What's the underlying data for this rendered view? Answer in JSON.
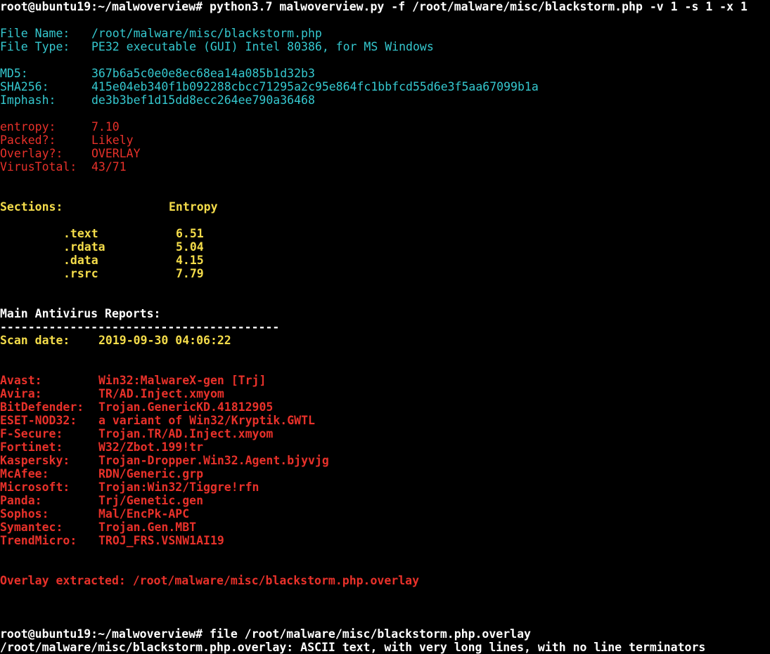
{
  "terminal": {
    "command_line": "root@ubuntu19:~/malwoverview# python3.7 malwoverview.py -f /root/malware/misc/blackstorm.php -v 1 -s 1 -x 1",
    "file_info": {
      "file_name_label": "File Name:",
      "file_name_value": "/root/malware/misc/blackstorm.php",
      "file_type_label": "File Type:",
      "file_type_value": "PE32 executable (GUI) Intel 80386, for MS Windows"
    },
    "hashes": {
      "md5_label": "MD5:",
      "md5_value": "367b6a5c0e0e8ec68ea14a085b1d32b3",
      "sha256_label": "SHA256:",
      "sha256_value": "415e04eb340f1b092288cbcc71295a2c95e864fc1bbfcd55d6e3f5aa67099b1a",
      "imphash_label": "Imphash:",
      "imphash_value": "de3b3bef1d15dd8ecc264ee790a36468"
    },
    "summary": {
      "entropy_label": "entropy:",
      "entropy_value": "7.10",
      "packed_label": "Packed?:",
      "packed_value": "Likely",
      "overlay_label": "Overlay?:",
      "overlay_value": "OVERLAY",
      "virustotal_label": "VirusTotal:",
      "virustotal_value": "43/71"
    },
    "sections": {
      "header_label": "Sections:",
      "header_entropy": "Entropy",
      "rows": [
        {
          "name": ".text",
          "entropy": "6.51"
        },
        {
          "name": ".rdata",
          "entropy": "5.04"
        },
        {
          "name": ".data",
          "entropy": "4.15"
        },
        {
          "name": ".rsrc",
          "entropy": "7.79"
        }
      ]
    },
    "av_reports": {
      "title": "Main Antivirus Reports:",
      "separator": "----------------------------------------",
      "scan_date_label": "Scan date:",
      "scan_date_value": "2019-09-30 04:06:22",
      "rows": [
        {
          "engine": "Avast:",
          "result": "Win32:MalwareX-gen [Trj]"
        },
        {
          "engine": "Avira:",
          "result": "TR/AD.Inject.xmyom"
        },
        {
          "engine": "BitDefender:",
          "result": "Trojan.GenericKD.41812905"
        },
        {
          "engine": "ESET-NOD32:",
          "result": "a variant of Win32/Kryptik.GWTL"
        },
        {
          "engine": "F-Secure:",
          "result": "Trojan.TR/AD.Inject.xmyom"
        },
        {
          "engine": "Fortinet:",
          "result": "W32/Zbot.199!tr"
        },
        {
          "engine": "Kaspersky:",
          "result": "Trojan-Dropper.Win32.Agent.bjyvjg"
        },
        {
          "engine": "McAfee:",
          "result": "RDN/Generic.grp"
        },
        {
          "engine": "Microsoft:",
          "result": "Trojan:Win32/Tiggre!rfn"
        },
        {
          "engine": "Panda:",
          "result": "Trj/Genetic.gen"
        },
        {
          "engine": "Sophos:",
          "result": "Mal/EncPk-APC"
        },
        {
          "engine": "Symantec:",
          "result": "Trojan.Gen.MBT"
        },
        {
          "engine": "TrendMicro:",
          "result": "TROJ_FRS.VSNW1AI19"
        }
      ]
    },
    "overlay_extracted": "Overlay extracted: /root/malware/misc/blackstorm.php.overlay",
    "second_command": "root@ubuntu19:~/malwoverview# file /root/malware/misc/blackstorm.php.overlay",
    "second_output": "/root/malware/misc/blackstorm.php.overlay: ASCII text, with very long lines, with no line terminators"
  },
  "colors": {
    "background": "#000000",
    "prompt": "#ffffff",
    "cyan": "#35c8cf",
    "red": "#e8312a",
    "yellow": "#f4dc4a"
  }
}
